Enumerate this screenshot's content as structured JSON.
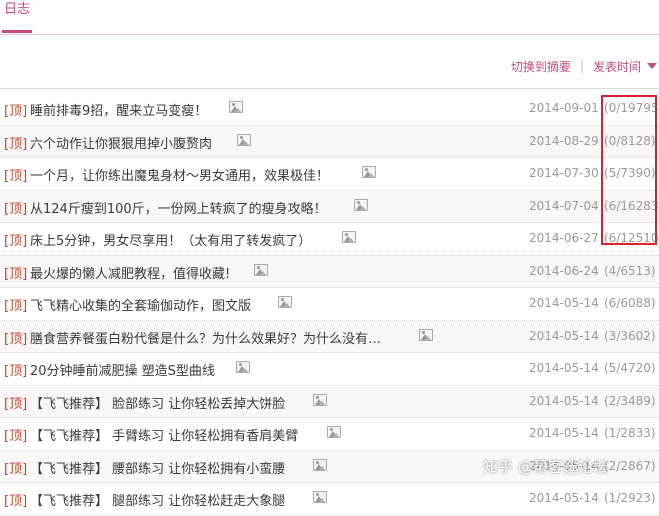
{
  "header": {
    "active_tab": "日志"
  },
  "toolbar": {
    "switch_view": "切换到摘要",
    "separator": "|",
    "sort_label": "发表时间"
  },
  "colors": {
    "accent": "#c6487f",
    "prefix": "#c2472b",
    "highlight_box": "#d9212b"
  },
  "icons": {
    "row_image": "image-icon",
    "sort_arrow": "triangle-down-icon"
  },
  "posts": [
    {
      "prefix": "[顶]",
      "title": "睡前排毒9招，醒来立马变瘦！",
      "date": "2014-09-01",
      "count": "(0/19795)"
    },
    {
      "prefix": "[顶]",
      "title": "六个动作让你狠狠甩掉小腹赘肉",
      "date": "2014-08-29",
      "count": "(0/8128)"
    },
    {
      "prefix": "[顶]",
      "title": "一个月，让你练出魔鬼身材～男女通用，效果极佳！",
      "date": "2014-07-30",
      "count": "(5/7390)"
    },
    {
      "prefix": "[顶]",
      "title": "从124斤瘦到100斤，一份网上转疯了的瘦身攻略！",
      "date": "2014-07-04",
      "count": "(6/16283)"
    },
    {
      "prefix": "[顶]",
      "title": "床上5分钟，男女尽享用！（太有用了转发疯了）",
      "date": "2014-06-27",
      "count": "(6/12510)"
    },
    {
      "prefix": "[顶]",
      "title": "最火爆的懒人减肥教程，值得收藏!",
      "date": "2014-06-24",
      "count": "(4/6513)"
    },
    {
      "prefix": "[顶]",
      "title": "飞飞精心收集的全套瑜伽动作，图文版",
      "date": "2014-05-14",
      "count": "(6/6088)"
    },
    {
      "prefix": "[顶]",
      "title": "膳食营养餐蛋白粉代餐是什么？为什么效果好？为什么没有…",
      "date": "2014-05-14",
      "count": "(3/3602)"
    },
    {
      "prefix": "[顶]",
      "title": "20分钟睡前减肥操 塑造S型曲线",
      "date": "2014-05-14",
      "count": "(5/4720)"
    },
    {
      "prefix": "[顶]",
      "title": "【飞飞推荐】 脸部练习 让你轻松丢掉大饼脸",
      "date": "2014-05-14",
      "count": "(2/3489)"
    },
    {
      "prefix": "[顶]",
      "title": "【飞飞推荐】 手臂练习 让你轻松拥有香肩美臂",
      "date": "2014-05-14",
      "count": "(1/2833)"
    },
    {
      "prefix": "[顶]",
      "title": "【飞飞推荐】 腰部练习 让你轻松拥有小蛮腰",
      "date": "2014-05-14",
      "count": "(2/2867)"
    },
    {
      "prefix": "[顶]",
      "title": "【飞飞推荐】 腿部练习 让你轻松赶走大象腿",
      "date": "2014-05-14",
      "count": "(1/2923)"
    }
  ],
  "watermark": "知乎 @帮客选论坛"
}
